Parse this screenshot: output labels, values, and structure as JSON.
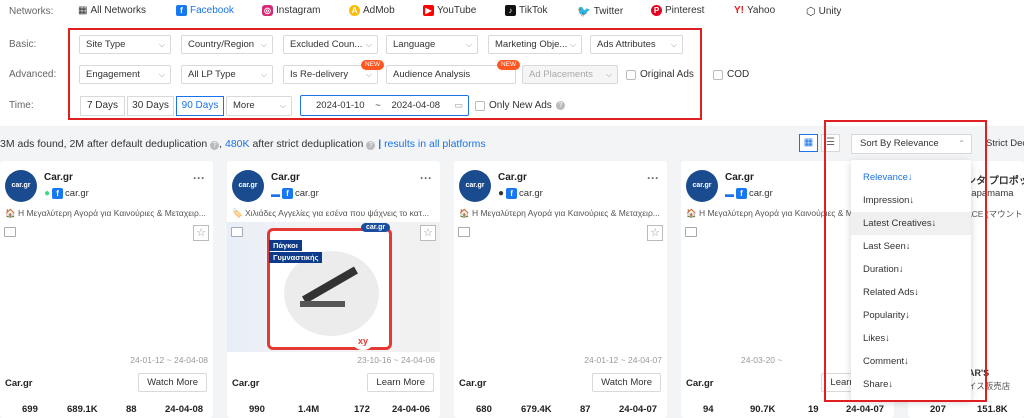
{
  "networks": {
    "label": "Networks:",
    "items": [
      {
        "label": "All Networks",
        "icon": "grid-icon"
      },
      {
        "label": "Facebook",
        "icon": "facebook-icon",
        "active": true
      },
      {
        "label": "Instagram",
        "icon": "instagram-icon"
      },
      {
        "label": "AdMob",
        "icon": "admob-icon"
      },
      {
        "label": "YouTube",
        "icon": "youtube-icon"
      },
      {
        "label": "TikTok",
        "icon": "tiktok-icon"
      },
      {
        "label": "Twitter",
        "icon": "twitter-icon"
      },
      {
        "label": "Pinterest",
        "icon": "pinterest-icon"
      },
      {
        "label": "Yahoo",
        "icon": "yahoo-icon"
      },
      {
        "label": "Unity",
        "icon": "unity-icon"
      }
    ]
  },
  "basic": {
    "label": "Basic:",
    "filters": [
      "Site Type",
      "Country/Region",
      "Excluded Coun...",
      "Language",
      "Marketing Obje...",
      "Ads Attributes"
    ]
  },
  "advanced": {
    "label": "Advanced:",
    "filters": [
      "Engagement",
      "All LP Type",
      "Is Re-delivery",
      "Audience Analysis",
      "Ad Placements"
    ],
    "new_badge": "NEW",
    "checkboxes": [
      "Original Ads",
      "COD"
    ]
  },
  "time": {
    "label": "Time:",
    "presets": [
      "7 Days",
      "30 Days",
      "90 Days"
    ],
    "active_preset": "90 Days",
    "more": "More",
    "start": "2024-01-10",
    "sep": "~",
    "end": "2024-04-08",
    "only_new": "Only New Ads"
  },
  "summary": {
    "part1": "3M ads found, 2M after default deduplication",
    "part2": "480K",
    "part3": "after strict deduplication",
    "divider": "|",
    "link": "results in all platforms"
  },
  "sort": {
    "selected": "Sort By Relevance",
    "strict_label": "Strict Dec",
    "options": [
      "Relevance↓",
      "Impression↓",
      "Latest Creatives↓",
      "Last Seen↓",
      "Duration↓",
      "Related Ads↓",
      "Popularity↓",
      "Likes↓",
      "Comment↓",
      "Share↓"
    ],
    "selected_option": "Relevance↓",
    "hovered_option": "Latest Creatives↓"
  },
  "cards": [
    {
      "advertiser": "Car.gr",
      "platform": "car.gr",
      "desc": "🏠 Η Μεγαλύτερη Αγορά για Καινούριες & Μεταχειρ...",
      "range": "24-01-12 ~ 24-04-08",
      "name": "Car.gr",
      "cta": "Watch More",
      "stats": [
        "699",
        "689.1K",
        "88",
        "24-04-08"
      ]
    },
    {
      "advertiser": "Car.gr",
      "platform": "car.gr",
      "desc": "🏷️ Χιλιάδες Αγγελίες για εσένα που ψάχνεις το κατ...",
      "range": "23-10-16 ~ 24-04-06",
      "name": "Car.gr",
      "cta": "Learn More",
      "stats": [
        "990",
        "1.4M",
        "172",
        "24-04-06"
      ],
      "tag1": "Πάγκοι",
      "tag2": "Γυμναστικής",
      "brand": "xy"
    },
    {
      "advertiser": "Car.gr",
      "platform": "car.gr",
      "desc": "🏠 Η Μεγαλύτερη Αγορά για Καινούριες & Μεταχειρ...",
      "range": "24-01-12 ~ 24-04-07",
      "name": "Car.gr",
      "cta": "Watch More",
      "stats": [
        "680",
        "679.4K",
        "87",
        "24-04-07"
      ]
    },
    {
      "advertiser": "Car.gr",
      "platform": "car.gr",
      "desc": "🏠 Η Μεγαλύτερη Αγορά για Καινούριες & Μεταχειρ...",
      "range": "24-03-20 ~",
      "name": "Car.gr",
      "cta": "Learn More",
      "stats": [
        "94",
        "90.7K",
        "19",
        "24-04-07"
      ]
    }
  ],
  "partial_card": {
    "title": "ンタ プロポッ",
    "platform": "papamama",
    "desc": "ACE (マウント",
    "name": "AR'S",
    "sub": "イス販売店",
    "stats": [
      "207",
      "151.8K"
    ]
  }
}
